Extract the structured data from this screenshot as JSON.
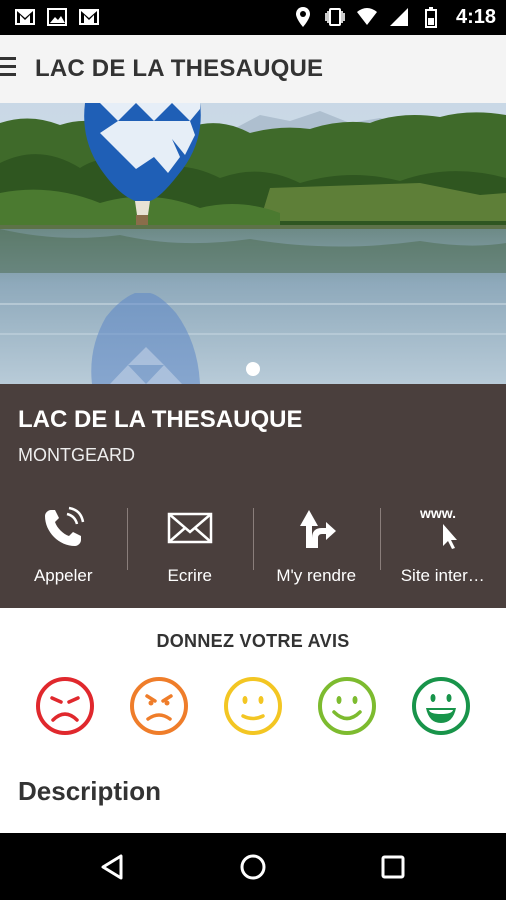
{
  "status_bar": {
    "left_icons": [
      "gmail-icon",
      "image-icon",
      "gmail-icon"
    ],
    "right_icons": [
      "location-icon",
      "vibrate-icon",
      "wifi-icon",
      "signal-icon",
      "battery-icon"
    ],
    "time": "4:18"
  },
  "app_bar": {
    "menu_icon": "menu-icon",
    "title": "LAC DE LA THESAUQUE"
  },
  "hero": {
    "image": "lake-with-hot-air-balloon",
    "page_count": 1,
    "current_page": 1
  },
  "info": {
    "title": "LAC DE LA THESAUQUE",
    "subtitle": "MONTGEARD",
    "background": "#4a3f3d",
    "actions": [
      {
        "label": "Appeler",
        "icon": "phone-icon"
      },
      {
        "label": "Ecrire",
        "icon": "envelope-icon"
      },
      {
        "label": "M'y rendre",
        "icon": "directions-icon"
      },
      {
        "label": "Site inter…",
        "icon": "website-icon",
        "icon_text": "www."
      }
    ]
  },
  "rating": {
    "title": "DONNEZ VOTRE AVIS",
    "smileys": [
      {
        "name": "very-sad",
        "color": "#e0282d"
      },
      {
        "name": "sad",
        "color": "#ef7d2a"
      },
      {
        "name": "neutral",
        "color": "#f3c623"
      },
      {
        "name": "happy",
        "color": "#7dbb2f"
      },
      {
        "name": "very-happy",
        "color": "#18944a"
      }
    ]
  },
  "description": {
    "heading": "Description"
  },
  "nav_bar": {
    "buttons": [
      "back-icon",
      "home-icon",
      "recents-icon"
    ]
  }
}
